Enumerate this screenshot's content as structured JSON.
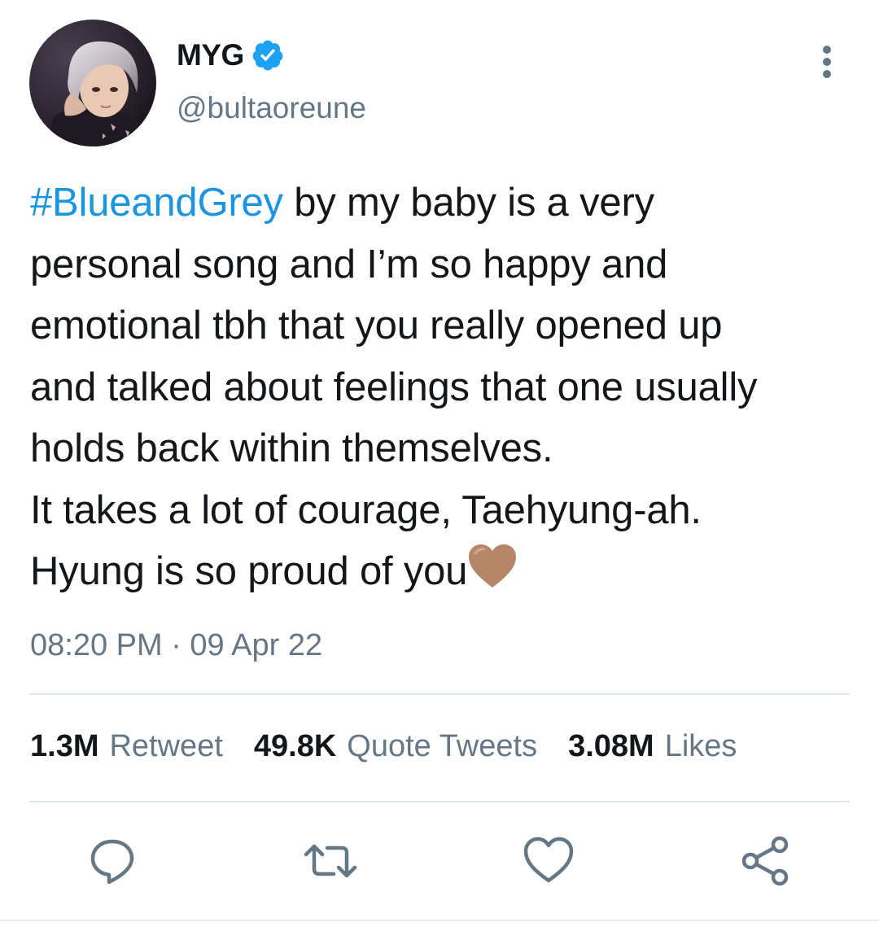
{
  "author": {
    "display_name": "MYG",
    "verified_icon": "verified-badge-icon",
    "handle": "@bultaoreune"
  },
  "tweet": {
    "hashtag": "#BlueandGrey",
    "line1_rest": " by my baby is a very",
    "line2": "personal song and I’m so happy and",
    "line3": "emotional tbh that you really opened up",
    "line4": "and talked about feelings that one usually",
    "line5": "holds back within themselves.",
    "line6": "It takes a lot of courage, Taehyung-ah.",
    "line7": "Hyung is so proud of you",
    "emoji": "brown-heart-emoji",
    "timestamp": "08:20 PM · 09 Apr 22"
  },
  "stats": {
    "retweets_count": "1.3M",
    "retweets_label": "Retweet",
    "quotes_count": "49.8K",
    "quotes_label": "Quote Tweets",
    "likes_count": "3.08M",
    "likes_label": "Likes"
  },
  "actions": [
    "reply-icon",
    "retweet-icon",
    "like-icon",
    "share-icon"
  ],
  "colors": {
    "hashtag": "#1b95e0",
    "verified": "#1da1f2",
    "secondary_text": "#657786",
    "primary_text": "#14171a",
    "divider": "#e1e8ed",
    "heart": "#b58768"
  }
}
